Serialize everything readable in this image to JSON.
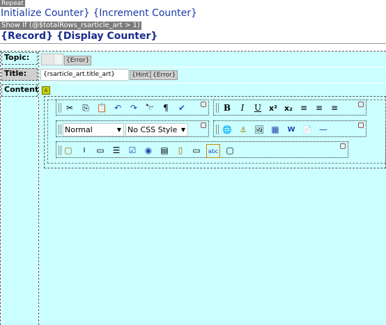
{
  "header": {
    "repeat_tag": "Repeat",
    "counter_line": "Initialize Counter} {Increment Counter}",
    "show_if": "Show If (@$totalRows_rsarticle_art > 1)",
    "record_line": "{Record} {Display Counter}"
  },
  "form": {
    "topic_label": "Topic:",
    "topic_error": "{Error}",
    "title_label": "Title:",
    "title_value": "{rsarticle_art.title_art}",
    "title_hint": "{Hint}",
    "title_error": "{Error}",
    "content_label": "Content:"
  },
  "editor": {
    "format_value": "Normal",
    "style_value": "No CSS Style",
    "row1_left_icons": [
      "cut-icon",
      "copy-icon",
      "paste-icon",
      "undo-icon",
      "redo-icon",
      "find-icon",
      "pilcrow-icon",
      "spellcheck-icon"
    ],
    "row1_left_glyphs": [
      "✂",
      "⎘",
      "📋",
      "↶",
      "↷",
      "🔭",
      "¶",
      "✔"
    ],
    "row1_right_glyphs": [
      "B",
      "I",
      "U",
      "x²",
      "x₂",
      "≡",
      "≡",
      "≡"
    ],
    "row1_right_icons": [
      "bold-icon",
      "italic-icon",
      "underline-icon",
      "superscript-icon",
      "subscript-icon",
      "align-left-icon",
      "align-center-icon",
      "align-right-icon"
    ],
    "row2_icons": [
      "hyperlink-icon",
      "anchor-icon",
      "image-icon",
      "table-icon",
      "word-icon",
      "template-icon",
      "horizontal-rule-icon"
    ],
    "row2_glyphs": [
      "🌐",
      "⚓",
      "🖼",
      "▦",
      "W",
      "📄",
      "—"
    ],
    "row3_icons": [
      "form-icon",
      "textfield-icon",
      "textarea-icon",
      "list-icon",
      "checkbox-icon",
      "radio-icon",
      "select-icon",
      "hidden-field-icon",
      "button-icon",
      "label-icon",
      "fieldset-icon"
    ],
    "row3_glyphs": [
      "▢",
      "I",
      "▭",
      "☰",
      "☑",
      "◉",
      "▤",
      "▯",
      "▭",
      "abc",
      "▢"
    ]
  },
  "colors": {
    "panel": "#ccffff",
    "title_blue": "#1a3aa8"
  }
}
